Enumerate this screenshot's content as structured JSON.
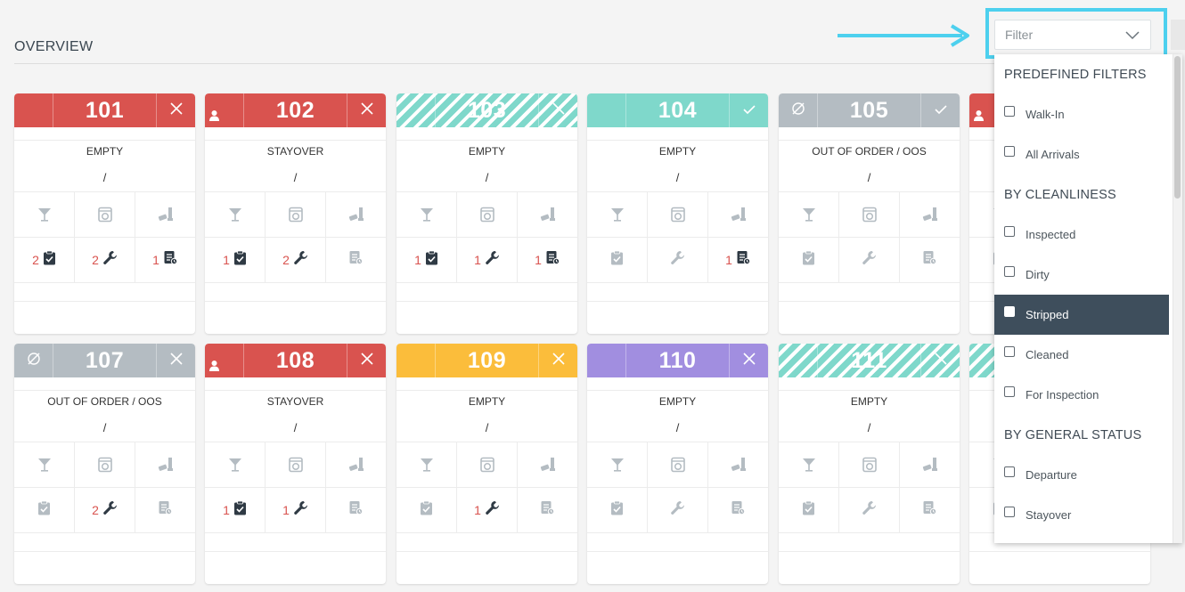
{
  "page": {
    "title": "OVERVIEW"
  },
  "filter": {
    "placeholder": "Filter",
    "groups": [
      {
        "heading": "PREDEFINED FILTERS",
        "items": [
          {
            "label": "Walk-In"
          },
          {
            "label": "All Arrivals"
          }
        ]
      },
      {
        "heading": "BY CLEANLINESS",
        "items": [
          {
            "label": "Inspected"
          },
          {
            "label": "Dirty"
          },
          {
            "label": "Stripped",
            "selected": true
          },
          {
            "label": "Cleaned"
          },
          {
            "label": "For Inspection"
          }
        ]
      },
      {
        "heading": "BY GENERAL STATUS",
        "items": [
          {
            "label": "Departure"
          },
          {
            "label": "Stayover"
          }
        ]
      }
    ]
  },
  "colors": {
    "red": "#d9534f",
    "teal": "#7fd8cb",
    "grey": "#b4bcc2",
    "yellow": "#fbbd3b",
    "purple": "#a18ee0",
    "highlight": "#4dd0ee",
    "selected": "#3e4e5c"
  },
  "rooms": [
    {
      "number": "101",
      "color": "red",
      "left": "",
      "right": "close",
      "status": "EMPTY",
      "slash": "/",
      "counts": [
        "2",
        "2",
        "1"
      ]
    },
    {
      "number": "102",
      "color": "red",
      "left": "user",
      "right": "close",
      "status": "STAYOVER",
      "slash": "/",
      "counts": [
        "1",
        "2",
        ""
      ]
    },
    {
      "number": "103",
      "color": "striped",
      "left": "",
      "right": "close",
      "status": "EMPTY",
      "slash": "/",
      "counts": [
        "1",
        "1",
        "1"
      ]
    },
    {
      "number": "104",
      "color": "teal",
      "left": "",
      "right": "check",
      "status": "EMPTY",
      "slash": "/",
      "counts": [
        "",
        "",
        "1"
      ]
    },
    {
      "number": "105",
      "color": "grey",
      "left": "forbidden",
      "right": "check",
      "status": "OUT OF ORDER / OOS",
      "slash": "/",
      "counts": [
        "",
        "",
        ""
      ]
    },
    {
      "number": "",
      "color": "red",
      "left": "user",
      "right": "",
      "status": "",
      "slash": "",
      "counts": [
        "",
        "",
        ""
      ]
    },
    {
      "number": "107",
      "color": "grey",
      "left": "forbidden",
      "right": "close",
      "status": "OUT OF ORDER / OOS",
      "slash": "/",
      "counts": [
        "",
        "2",
        ""
      ]
    },
    {
      "number": "108",
      "color": "red",
      "left": "user",
      "right": "close",
      "status": "STAYOVER",
      "slash": "/",
      "counts": [
        "1",
        "1",
        ""
      ]
    },
    {
      "number": "109",
      "color": "yellow",
      "left": "",
      "right": "close",
      "status": "EMPTY",
      "slash": "/",
      "counts": [
        "",
        "1",
        ""
      ]
    },
    {
      "number": "110",
      "color": "purple",
      "left": "",
      "right": "close",
      "status": "EMPTY",
      "slash": "/",
      "counts": [
        "",
        "",
        ""
      ]
    },
    {
      "number": "111",
      "color": "striped",
      "left": "",
      "right": "close",
      "status": "EMPTY",
      "slash": "/",
      "counts": [
        "",
        "",
        ""
      ]
    },
    {
      "number": "",
      "color": "striped",
      "left": "",
      "right": "",
      "status": "",
      "slash": "",
      "counts": [
        "",
        "",
        ""
      ]
    }
  ]
}
